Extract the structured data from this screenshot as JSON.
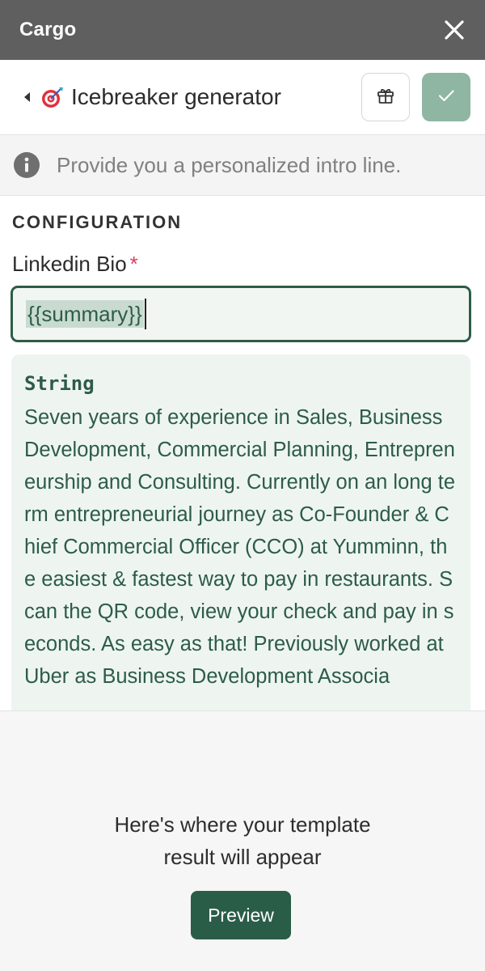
{
  "window": {
    "app_name": "Cargo",
    "close_icon": "close-icon"
  },
  "header": {
    "back_icon": "caret-left-icon",
    "emoji_icon": "dart-target-icon",
    "title": "Icebreaker generator",
    "gift_icon": "gift-icon",
    "confirm_icon": "check-icon",
    "accent_color": "#8fb5a3"
  },
  "info": {
    "icon": "info-icon",
    "text": "Provide you a personalized intro line."
  },
  "configuration": {
    "section_label": "CONFIGURATION",
    "field": {
      "label": "Linkedin Bio",
      "required_mark": "*",
      "value": "{{summary}}"
    },
    "resolved": {
      "type": "String",
      "text": "Seven years of experience in Sales, Business Development, Commercial Planning, Entrepreneurship and Consulting. Currently on an long term entrepreneurial journey as Co-Founder & Chief Commercial Officer (CCO) at Yumminn, the easiest & fastest way to pay in restaurants. Scan the QR code, view your check and pay in seconds. As easy as that! Previously worked at Uber as Business Development Associa"
    }
  },
  "result": {
    "hint": "Here's where your template result will appear",
    "preview_button": "Preview",
    "brand_color": "#2a5d47"
  }
}
